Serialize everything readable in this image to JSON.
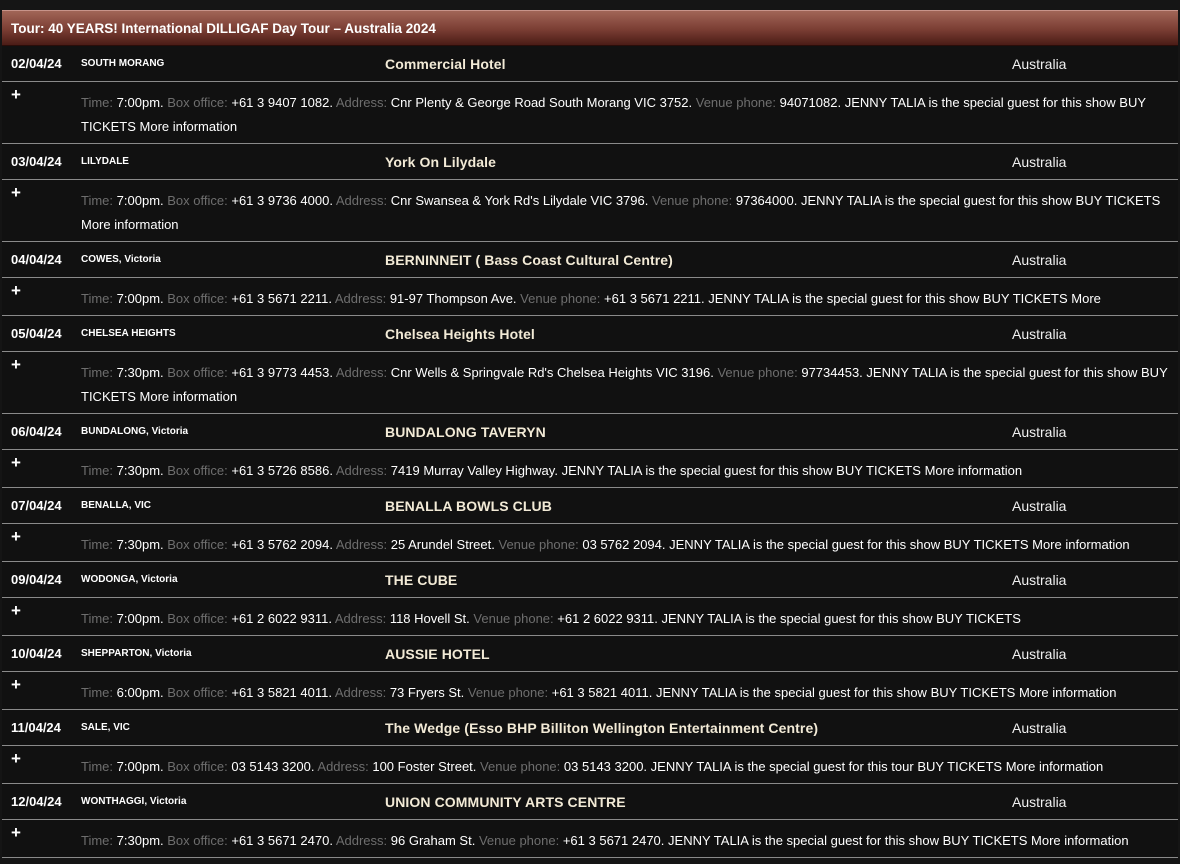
{
  "tour_title": "Tour: 40 YEARS! International DILLIGAF Day Tour – Australia 2024",
  "labels": {
    "time": "Time:",
    "box_office": "Box office:",
    "address": "Address:",
    "venue_phone": "Venue phone:",
    "buy": "BUY TICKETS",
    "more": "More information",
    "expand": "+"
  },
  "gigs": [
    {
      "date": "02/04/24",
      "city": "SOUTH MORANG",
      "state": "",
      "venue": "Commercial Hotel",
      "country": "Australia",
      "time": "7:00pm.",
      "box_office": "+61 3 9407 1082.",
      "address": "Cnr Plenty & George Road South Morang VIC 3752.",
      "venue_phone": "94071082.",
      "note": "JENNY TALIA is the special guest for this show"
    },
    {
      "date": "03/04/24",
      "city": "LILYDALE",
      "state": "",
      "venue": "York On Lilydale",
      "country": "Australia",
      "time": "7:00pm.",
      "box_office": "+61 3 9736 4000.",
      "address": "Cnr Swansea & York Rd's Lilydale VIC 3796.",
      "venue_phone": "97364000.",
      "note": "JENNY TALIA is the special guest for this show"
    },
    {
      "date": "04/04/24",
      "city": "COWES,",
      "state": "Victoria",
      "venue": "BERNINNEIT ( Bass Coast Cultural Centre)",
      "country": "Australia",
      "time": "7:00pm.",
      "box_office": "+61 3 5671 2211.",
      "address": "91-97 Thompson Ave.",
      "venue_phone": "+61 3 5671 2211.",
      "note": "JENNY TALIA is the special guest for this show"
    },
    {
      "date": "05/04/24",
      "city": "CHELSEA HEIGHTS",
      "state": "",
      "venue": "Chelsea Heights Hotel",
      "country": "Australia",
      "time": "7:30pm.",
      "box_office": "+61 3 9773 4453.",
      "address": "Cnr Wells & Springvale Rd's Chelsea Heights VIC 3196.",
      "venue_phone": "97734453.",
      "note": "JENNY TALIA is the special guest for this show"
    },
    {
      "date": "06/04/24",
      "city": "BUNDALONG,",
      "state": "Victoria",
      "venue": "BUNDALONG TAVERYN",
      "country": "Australia",
      "time": "7:30pm.",
      "box_office": "+61 3 5726 8586.",
      "address": "7419 Murray Valley Highway.",
      "venue_phone": "",
      "note": "JENNY TALIA is the special guest for this show"
    },
    {
      "date": "07/04/24",
      "city": "BENALLA,",
      "state": "VIC",
      "venue": "BENALLA BOWLS CLUB",
      "country": "Australia",
      "time": "7:30pm.",
      "box_office": "+61 3 5762 2094.",
      "address": "25 Arundel Street.",
      "venue_phone": "03 5762 2094.",
      "note": "JENNY TALIA is the special guest for this show"
    },
    {
      "date": "09/04/24",
      "city": "WODONGA,",
      "state": "Victoria",
      "venue": "THE CUBE",
      "country": "Australia",
      "time": "7:00pm.",
      "box_office": "+61 2 6022 9311.",
      "address": "118 Hovell St.",
      "venue_phone": "+61 2 6022 9311.",
      "note": "JENNY TALIA is the special guest for this show"
    },
    {
      "date": "10/04/24",
      "city": "SHEPPARTON,",
      "state": "Victoria",
      "venue": "AUSSIE HOTEL",
      "country": "Australia",
      "time": "6:00pm.",
      "box_office": "+61 3 5821 4011.",
      "address": "73 Fryers St.",
      "venue_phone": "+61 3 5821 4011.",
      "note": "JENNY TALIA is the special guest for this show"
    },
    {
      "date": "11/04/24",
      "city": "SALE,",
      "state": "VIC",
      "venue": "The Wedge (Esso BHP Billiton Wellington Entertainment Centre)",
      "country": "Australia",
      "time": "7:00pm.",
      "box_office": "03 5143 3200.",
      "address": "100 Foster Street.",
      "venue_phone": "03 5143 3200.",
      "note": "JENNY TALIA is the special guest for this tour"
    },
    {
      "date": "12/04/24",
      "city": "WONTHAGGI,",
      "state": "Victoria",
      "venue": "UNION COMMUNITY ARTS CENTRE",
      "country": "Australia",
      "time": "7:30pm.",
      "box_office": "+61 3 5671 2470.",
      "address": "96 Graham St.",
      "venue_phone": "+61 3 5671 2470.",
      "note": "JENNY TALIA is the special guest for this show"
    }
  ]
}
